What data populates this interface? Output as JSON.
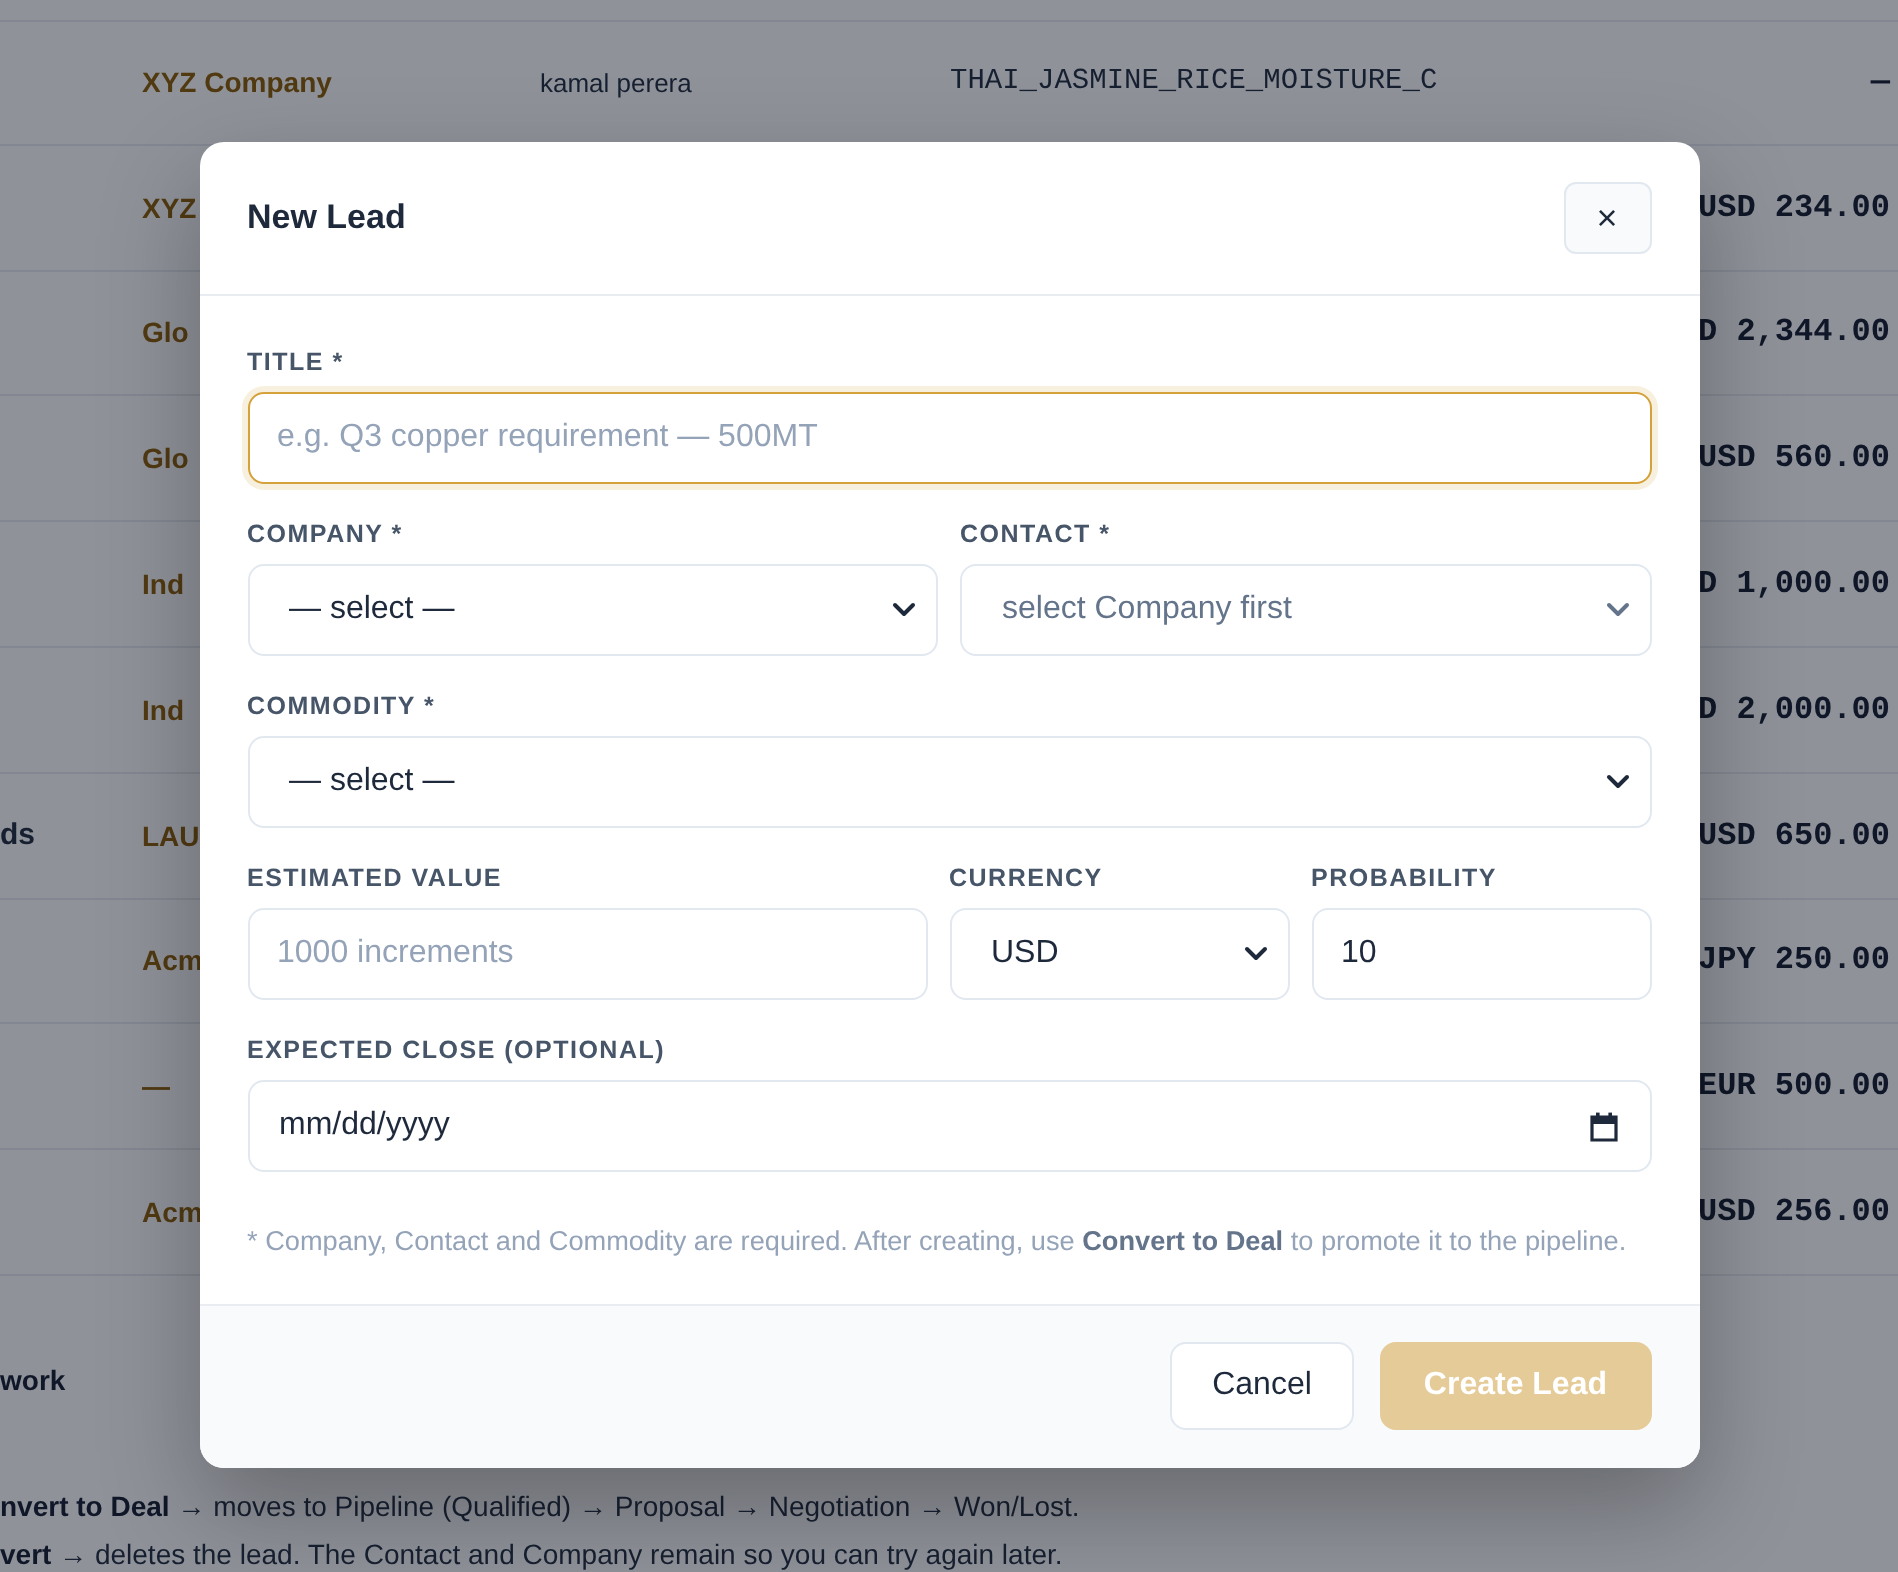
{
  "background": {
    "rows": [
      {
        "company": "XYZ Company",
        "contact": "kamal perera",
        "commodity": "THAI_JASMINE_RICE_MOISTURE_C",
        "value": "—"
      },
      {
        "company": "XYZ",
        "value": "USD 234.00"
      },
      {
        "company": "Glo",
        "value": "D 2,344.00"
      },
      {
        "company": "Glo",
        "value": "USD 560.00"
      },
      {
        "company": "Ind",
        "value": "D 1,000.00"
      },
      {
        "company": "Ind",
        "value": "D 2,000.00"
      },
      {
        "aside": "ds",
        "company": "LAU",
        "value": "USD 650.00"
      },
      {
        "company": "Acm",
        "value": "JPY 250.00"
      },
      {
        "company": "—",
        "value": "EUR 500.00"
      },
      {
        "company": "Acm",
        "value": "USD 256.00"
      }
    ],
    "section_heading": "work",
    "notes": [
      "**nvert to Deal** → moves to Pipeline (Qualified) → Proposal → Negotiation → Won/Lost.",
      "**vert** → deletes the lead. The Contact and Company remain so you can try again later."
    ]
  },
  "modal": {
    "title": "New Lead",
    "close_label": "×",
    "rows": [
      [
        {
          "kind": "text",
          "label": "TITLE *",
          "placeholder": "e.g. Q3 copper requirement — 500MT",
          "focused": true
        }
      ],
      [
        {
          "kind": "select",
          "label": "COMPANY *",
          "value": "— select —",
          "disabled": false
        },
        {
          "kind": "select",
          "label": "CONTACT *",
          "value": "select Company first",
          "disabled": true
        }
      ],
      [
        {
          "kind": "select",
          "label": "COMMODITY *",
          "value": "— select —",
          "disabled": false
        }
      ],
      [
        {
          "kind": "text",
          "label": "ESTIMATED VALUE",
          "placeholder": "1000 increments",
          "focused": false
        },
        {
          "kind": "select",
          "label": "CURRENCY",
          "value": "USD",
          "disabled": false
        },
        {
          "kind": "text",
          "label": "PROBABILITY",
          "value": "10",
          "focused": false
        }
      ],
      [
        {
          "kind": "date",
          "label": "EXPECTED CLOSE (OPTIONAL)",
          "placeholder": "mm/dd/yyyy"
        }
      ]
    ],
    "note": "* Company, Contact and Commodity are required. After creating, use **Convert to Deal** to promote it to the pipeline.",
    "buttons": [
      {
        "kind": "secondary",
        "label": "Cancel",
        "disabled": false
      },
      {
        "kind": "primary",
        "label": "Create Lead",
        "disabled": true
      }
    ]
  }
}
